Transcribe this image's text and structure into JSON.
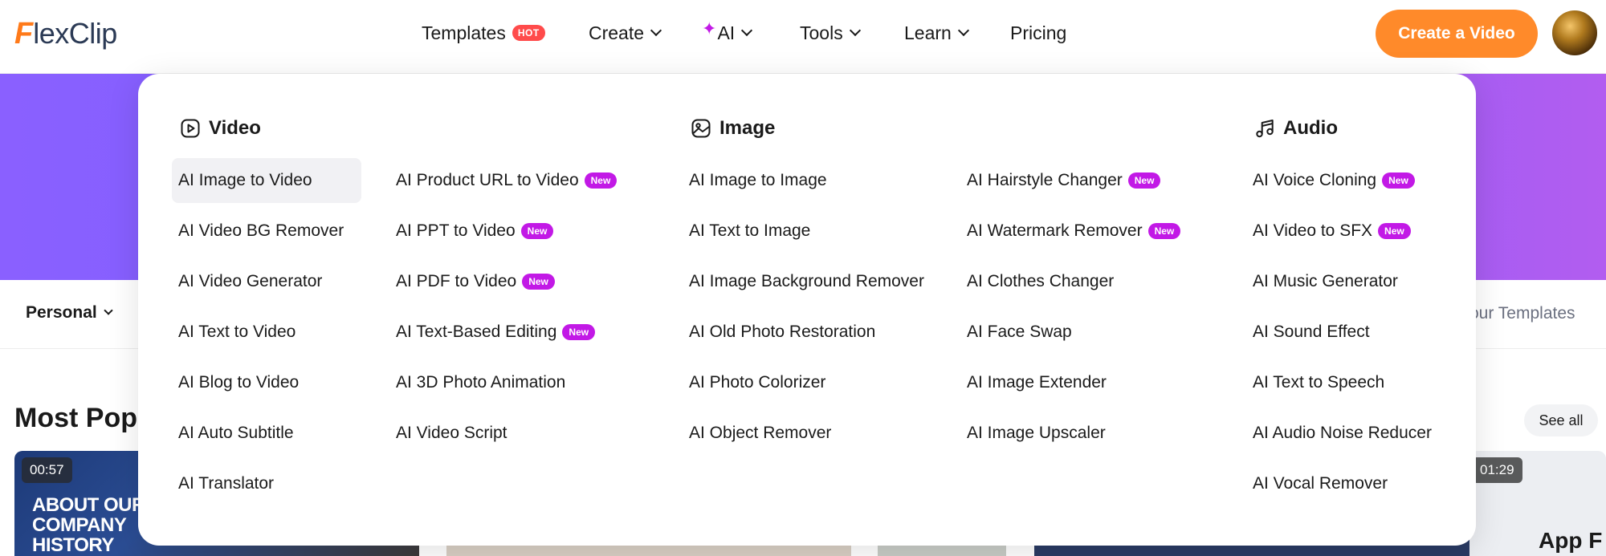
{
  "brand": {
    "logo_mark": "F",
    "logo_text": "lexClip"
  },
  "nav": {
    "templates": "Templates",
    "hot_badge": "HOT",
    "create": "Create",
    "ai": "AI",
    "tools": "Tools",
    "learn": "Learn",
    "pricing": "Pricing"
  },
  "cta": "Create a Video",
  "page": {
    "personal": "Personal",
    "your_templates": "our Templates",
    "most_popular": "Most Popu",
    "see_all": "See all",
    "thumb1_text": "ABOUT OUR\nCOMPANY\nHISTORY",
    "thumb1_time": "00:57",
    "thumb5_text": "App F",
    "thumb5_time": "01:29"
  },
  "new_badge": "New",
  "menu": {
    "video": {
      "heading": "Video",
      "col1": [
        "AI Image to Video",
        "AI Video BG Remover",
        "AI Video Generator",
        "AI Text to Video",
        "AI Blog to Video",
        "AI Auto Subtitle",
        "AI Translator"
      ],
      "col2": [
        "AI Product URL to Video",
        "AI PPT to Video",
        "AI PDF to Video",
        "AI Text-Based Editing",
        "AI 3D Photo Animation",
        "AI Video Script"
      ]
    },
    "image": {
      "heading": "Image",
      "col1": [
        "AI Image to Image",
        "AI Text to Image",
        "AI Image Background Remover",
        "AI Old Photo Restoration",
        "AI Photo Colorizer",
        "AI Object Remover"
      ],
      "col2": [
        "AI Hairstyle Changer",
        "AI Watermark Remover",
        "AI Clothes Changer",
        "AI Face Swap",
        "AI Image Extender",
        "AI Image Upscaler"
      ]
    },
    "audio": {
      "heading": "Audio",
      "col1": [
        "AI Voice Cloning",
        "AI Video to SFX",
        "AI Music Generator",
        "AI Sound Effect",
        "AI Text to Speech",
        "AI Audio Noise Reducer",
        "AI Vocal Remover"
      ]
    }
  },
  "colors": {
    "accent": "#ff8a2a",
    "new_badge": "#c219e6",
    "hot_badge": "#ff4b4b",
    "hero": "#7a5cff"
  },
  "icons": {
    "video": "play-square-icon",
    "image": "image-icon",
    "audio": "music-note-icon",
    "ai": "sparkle-icon"
  }
}
